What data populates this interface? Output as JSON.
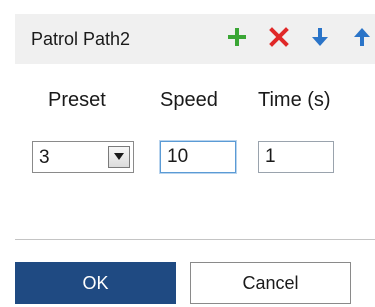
{
  "header": {
    "title": "Patrol Path2",
    "actions": [
      {
        "name": "add",
        "icon": "plus-icon",
        "color": "#3aa635"
      },
      {
        "name": "delete",
        "icon": "x-icon",
        "color": "#e02828"
      },
      {
        "name": "move-down",
        "icon": "arrow-down-icon",
        "color": "#2a74c8"
      },
      {
        "name": "move-up",
        "icon": "arrow-up-icon",
        "color": "#2a74c8"
      }
    ]
  },
  "columns": {
    "preset": "Preset",
    "speed": "Speed",
    "time": "Time (s)"
  },
  "row": {
    "preset": "3",
    "speed": "10",
    "time": "1"
  },
  "footer": {
    "ok_label": "OK",
    "cancel_label": "Cancel"
  },
  "colors": {
    "header_bg": "#f0f0f0",
    "primary": "#1f4a82"
  }
}
